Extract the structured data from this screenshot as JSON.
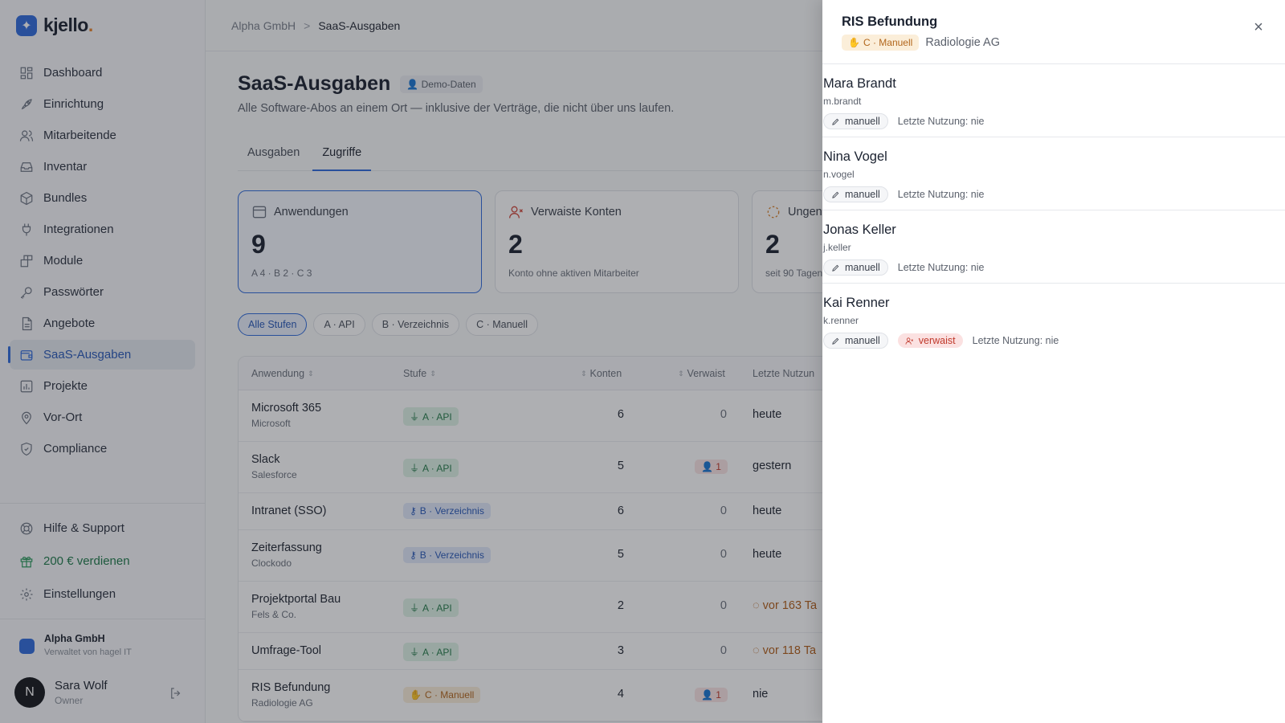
{
  "app": {
    "logo_text": "kjello",
    "logo_dot": "."
  },
  "sidebar": {
    "items": [
      {
        "label": "Dashboard",
        "icon": "grid-icon"
      },
      {
        "label": "Einrichtung",
        "icon": "rocket-icon"
      },
      {
        "label": "Mitarbeitende",
        "icon": "users-icon"
      },
      {
        "label": "Inventar",
        "icon": "inbox-icon"
      },
      {
        "label": "Bundles",
        "icon": "package-icon"
      },
      {
        "label": "Integrationen",
        "icon": "plug-icon"
      },
      {
        "label": "Module",
        "icon": "blocks-icon"
      },
      {
        "label": "Passwörter",
        "icon": "key-icon"
      },
      {
        "label": "Angebote",
        "icon": "document-icon"
      },
      {
        "label": "SaaS-Ausgaben",
        "icon": "wallet-icon",
        "active": true
      },
      {
        "label": "Projekte",
        "icon": "chart-icon"
      },
      {
        "label": "Vor-Ort",
        "icon": "map-pin-icon"
      },
      {
        "label": "Compliance",
        "icon": "shield-icon"
      }
    ],
    "bottom": {
      "help": "Hilfe & Support",
      "earn": "200 € verdienen",
      "settings": "Einstellungen"
    },
    "org": {
      "name": "Alpha GmbH",
      "sub": "Verwaltet von hagel IT"
    },
    "user": {
      "initial": "N",
      "name": "Sara Wolf",
      "role": "Owner"
    }
  },
  "breadcrumb": {
    "org": "Alpha GmbH",
    "sep": ">",
    "page": "SaaS-Ausgaben"
  },
  "page": {
    "title": "SaaS-Ausgaben",
    "badge": "Demo-Daten",
    "subtitle": "Alle Software-Abos an einem Ort — inklusive der Verträge, die nicht über uns laufen."
  },
  "tabs": [
    "Ausgaben",
    "Zugriffe"
  ],
  "cards": [
    {
      "label": "Anwendungen",
      "value": "9",
      "foot": "A 4 · B 2 · C 3"
    },
    {
      "label": "Verwaiste Konten",
      "value": "2",
      "foot": "Konto ohne aktiven Mitarbeiter"
    },
    {
      "label": "Ungen",
      "value": "2",
      "foot": "seit 90 Tagen"
    }
  ],
  "filters": [
    "Alle Stufen",
    "A · API",
    "B · Verzeichnis",
    "C · Manuell"
  ],
  "table": {
    "headers": {
      "app": "Anwendung",
      "stufe": "Stufe",
      "konten": "Konten",
      "verwaist": "Verwaist",
      "last": "Letzte Nutzun"
    },
    "rows": [
      {
        "name": "Microsoft 365",
        "vendor": "Microsoft",
        "stufe": "A · API",
        "konten": "6",
        "verwaist": "0",
        "last": "heute"
      },
      {
        "name": "Slack",
        "vendor": "Salesforce",
        "stufe": "A · API",
        "konten": "5",
        "verwaist": "1",
        "last": "gestern"
      },
      {
        "name": "Intranet (SSO)",
        "vendor": "",
        "stufe": "B · Verzeichnis",
        "konten": "6",
        "verwaist": "0",
        "last": "heute"
      },
      {
        "name": "Zeiterfassung",
        "vendor": "Clockodo",
        "stufe": "B · Verzeichnis",
        "konten": "5",
        "verwaist": "0",
        "last": "heute"
      },
      {
        "name": "Projektportal Bau",
        "vendor": "Fels & Co.",
        "stufe": "A · API",
        "konten": "2",
        "verwaist": "0",
        "last": "vor 163 Ta"
      },
      {
        "name": "Umfrage-Tool",
        "vendor": "",
        "stufe": "A · API",
        "konten": "3",
        "verwaist": "0",
        "last": "vor 118 Ta"
      },
      {
        "name": "RIS Befundung",
        "vendor": "Radiologie AG",
        "stufe": "C · Manuell",
        "konten": "4",
        "verwaist": "1",
        "last": "nie"
      }
    ]
  },
  "drawer": {
    "title": "RIS Befundung",
    "stufe": "C · Manuell",
    "vendor": "Radiologie AG",
    "close": "×",
    "accounts": [
      {
        "name": "Mara Brandt",
        "login": "m.brandt",
        "source": "manuell",
        "usage": "Letzte Nutzung: nie"
      },
      {
        "name": "Nina Vogel",
        "login": "n.vogel",
        "source": "manuell",
        "usage": "Letzte Nutzung: nie"
      },
      {
        "name": "Jonas Keller",
        "login": "j.keller",
        "source": "manuell",
        "usage": "Letzte Nutzung: nie"
      },
      {
        "name": "Kai Renner",
        "login": "k.renner",
        "source": "manuell",
        "orphan": "verwaist",
        "usage": "Letzte Nutzung: nie"
      }
    ]
  }
}
